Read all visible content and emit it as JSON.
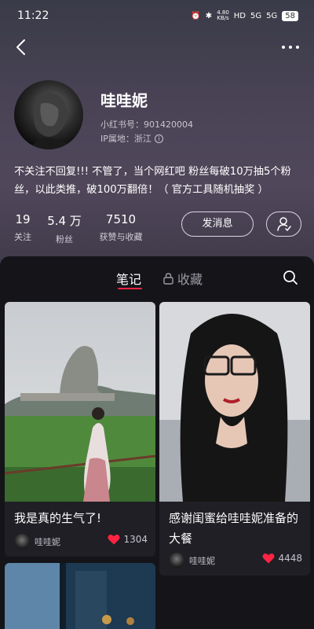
{
  "status_bar": {
    "time": "11:22",
    "net_speed": "4.80",
    "net_unit": "KB/s",
    "hd": "HD",
    "sig1": "5G",
    "sig2": "5G",
    "battery": "58"
  },
  "profile": {
    "nickname": "哇哇妮",
    "red_id": "小红书号：901420004",
    "ip_location": "IP属地：浙江",
    "bio": "不关注不回复!!! 不管了，当个网红吧 粉丝每破10万抽5个粉丝，以此类推，破100万翻倍！（ 官方工具随机抽奖 ）",
    "stats": [
      {
        "value": "19",
        "label": "关注"
      },
      {
        "value": "5.4 万",
        "label": "粉丝"
      },
      {
        "value": "7510",
        "label": "获赞与收藏"
      }
    ],
    "message_button": "发消息"
  },
  "tabs": {
    "notes": "笔记",
    "favorites": "收藏"
  },
  "notes": [
    {
      "title": "我是真的生气了!",
      "author": "哇哇妮",
      "likes": "1304"
    },
    {
      "title": "感谢闺蜜给哇哇妮准备的大餐",
      "author": "哇哇妮",
      "likes": "4448"
    }
  ],
  "colors": {
    "accent": "#ff2442",
    "like": "#ff2442"
  }
}
